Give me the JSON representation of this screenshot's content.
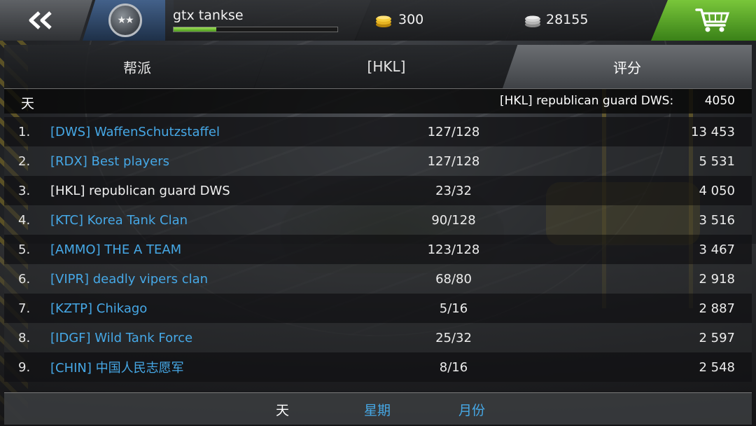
{
  "topbar": {
    "back_icon": "double-chevron-left-icon",
    "rank_stars": "★★",
    "player_name": "gtx tankse",
    "xp_fraction": 0.26,
    "gold_value": "300",
    "silver_value": "28155",
    "shop_icon": "shopping-cart-icon",
    "colors": {
      "gold": "#e6b422",
      "silver": "#c8c8c8",
      "shop": "#5aa52a",
      "rank_slot": "#2f4a6e"
    }
  },
  "tabs": {
    "clan": "帮派",
    "hkl": "[HKL]",
    "rating": "评分"
  },
  "header": {
    "period": "天",
    "my_clan": "[HKL] republican guard DWS:",
    "my_score": "4050"
  },
  "rows": [
    {
      "rank": "1.",
      "name": "[DWS] WaffenSchutzstaffel",
      "members": "127/128",
      "score": "13 453"
    },
    {
      "rank": "2.",
      "name": "[RDX] Best players",
      "members": "127/128",
      "score": "5 531"
    },
    {
      "rank": "3.",
      "name": "[HKL] republican guard DWS",
      "members": "23/32",
      "score": "4 050"
    },
    {
      "rank": "4.",
      "name": "[KTC] Korea Tank Clan",
      "members": "90/128",
      "score": "3 516"
    },
    {
      "rank": "5.",
      "name": "[AMMO] THE A TEAM",
      "members": "123/128",
      "score": "3 467"
    },
    {
      "rank": "6.",
      "name": "[VIPR] deadly vipers clan",
      "members": "68/80",
      "score": "2 918"
    },
    {
      "rank": "7.",
      "name": "[KZTP] Chikago",
      "members": "5/16",
      "score": "2 887"
    },
    {
      "rank": "8.",
      "name": "[IDGF] Wild Tank Force",
      "members": "25/32",
      "score": "2 597"
    },
    {
      "rank": "9.",
      "name": "[CHIN] 中国人民志愿军",
      "members": "8/16",
      "score": "2 548"
    }
  ],
  "filters": {
    "day": "天",
    "week": "星期",
    "month": "月份"
  },
  "colors": {
    "link_blue": "#46a8e6",
    "own_clan": "#f0f0f0",
    "xp_green": "#6cc234"
  }
}
